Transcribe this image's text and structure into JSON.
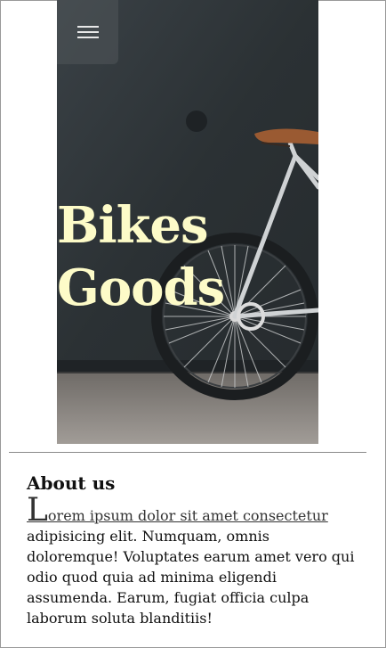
{
  "hero": {
    "title_line1": "Bikes",
    "title_line2": "Goods",
    "menu_icon": "hamburger-icon"
  },
  "about": {
    "heading": "About us",
    "lead_first_letter": "L",
    "lead_link_text": "orem ipsum dolor sit amet consectetur",
    "body": "adipisicing elit. Numquam, omnis doloremque! Voluptates earum amet vero qui odio quod quia ad minima eligendi assumenda. Earum, fugiat officia culpa laborum soluta blanditiis!"
  },
  "colors": {
    "hero_title": "#fdfbc8",
    "wall": "#2f3538",
    "floor": "#8e8a85"
  }
}
